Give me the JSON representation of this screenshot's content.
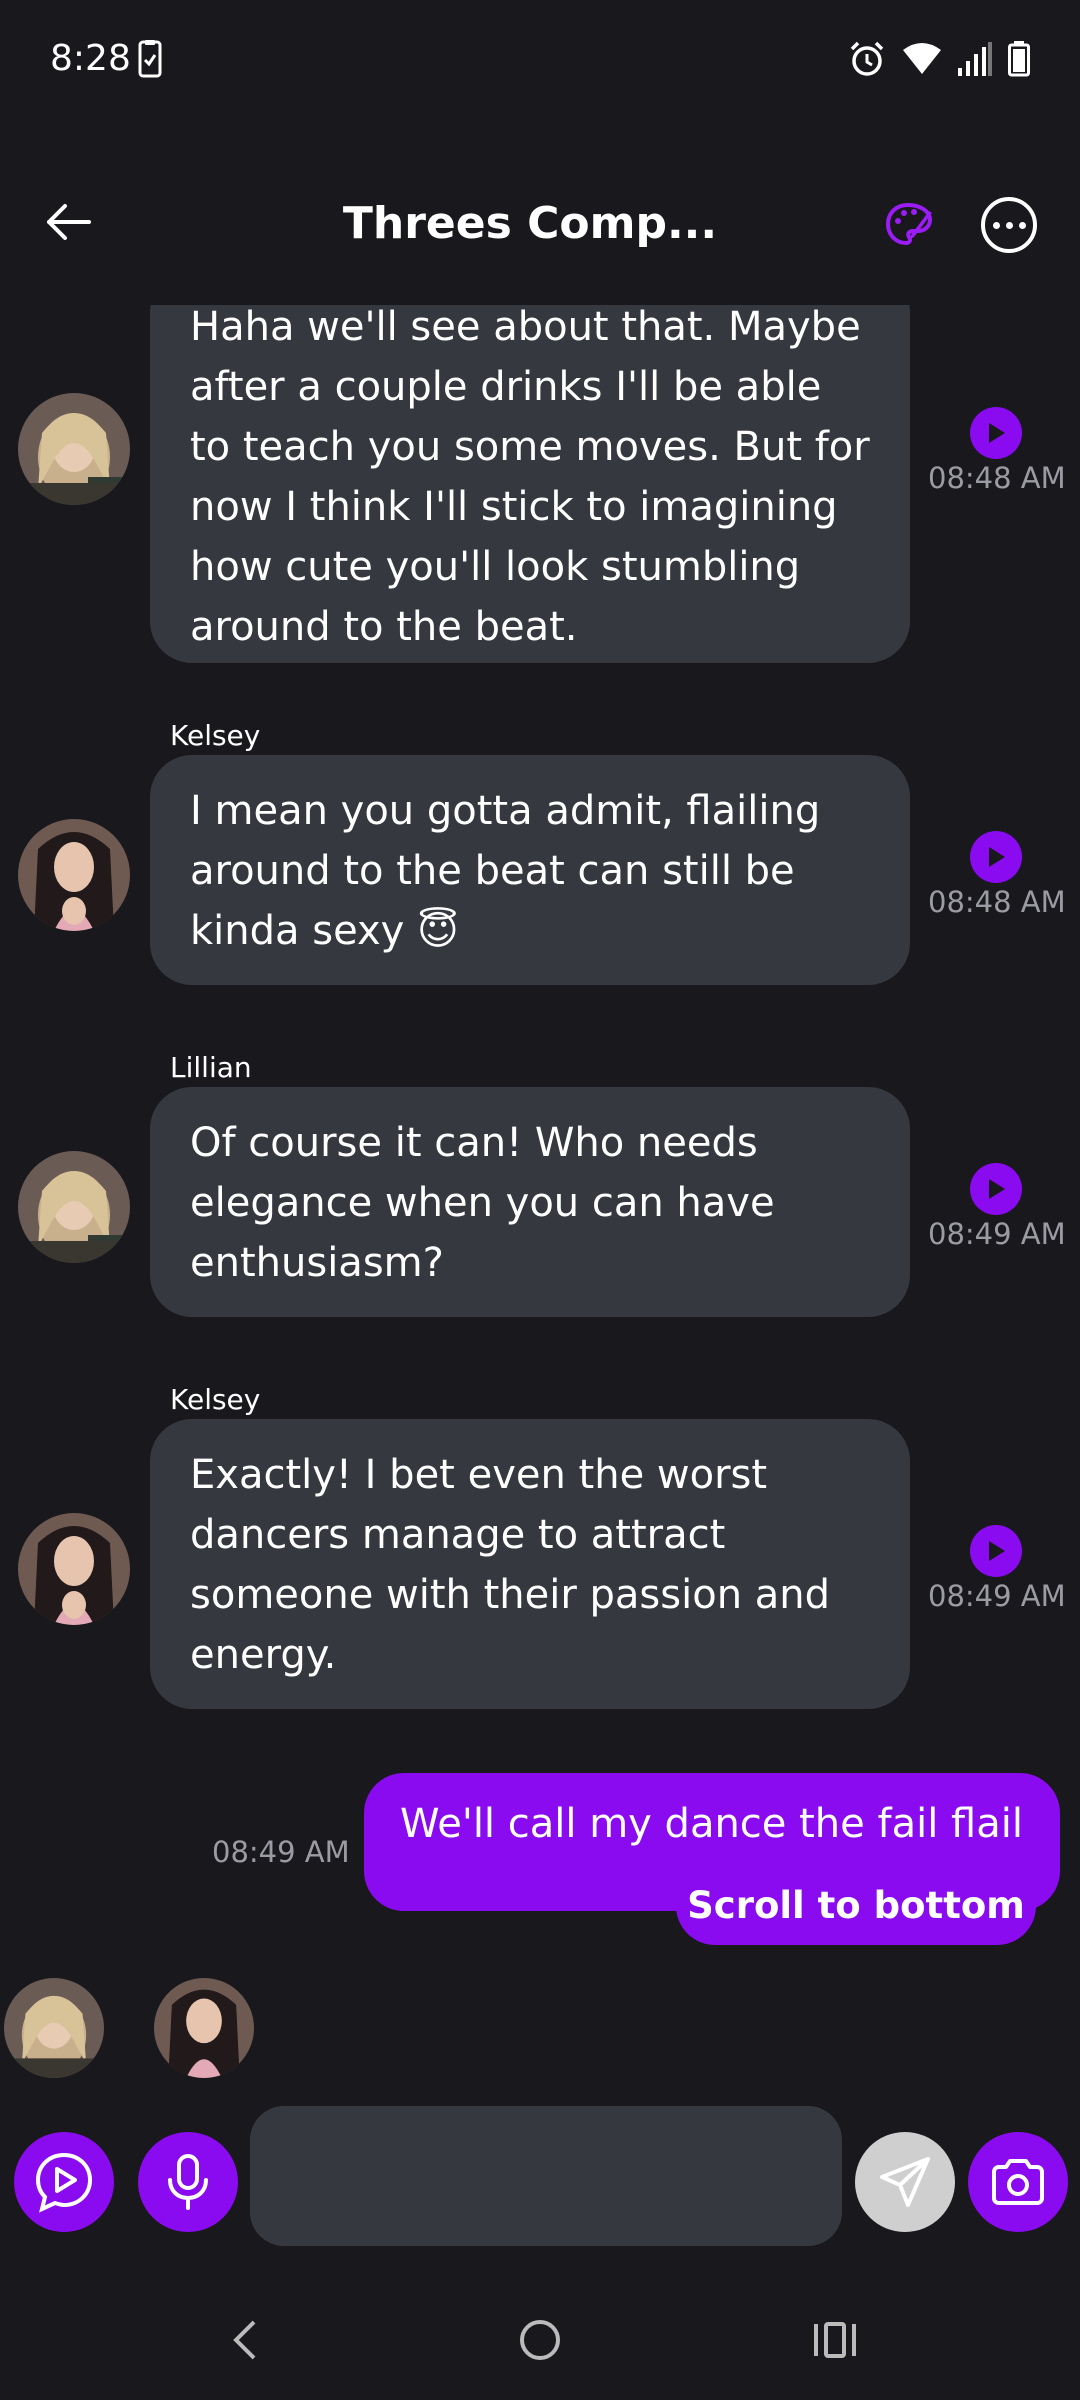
{
  "status_bar": {
    "time": "8:28"
  },
  "header": {
    "title": "Threes Comp..."
  },
  "messages": [
    {
      "sender": "",
      "text": "Haha we'll see about that. Maybe after a couple drinks I'll be able to teach you some moves. But for now I think I'll stick to imagining how cute you'll look stumbling around to the beat.",
      "time": "08:48 AM"
    },
    {
      "sender": "Kelsey",
      "text": "I mean you gotta admit, flailing around to the beat can still be kinda sexy 😇",
      "time": "08:48 AM"
    },
    {
      "sender": "Lillian",
      "text": "Of course it can! Who needs elegance when you can have enthusiasm?",
      "time": "08:49 AM"
    },
    {
      "sender": "Kelsey",
      "text": "Exactly! I bet even the worst dancers manage to attract someone with their passion and energy.",
      "time": "08:49 AM"
    }
  ],
  "outgoing": {
    "text": "We'll call my dance the fail flail",
    "time": "08:49 AM"
  },
  "scroll_to_bottom_label": "Scroll to bottom",
  "input": {
    "placeholder": ""
  },
  "colors": {
    "accent": "#8b0bf0",
    "background": "#18181d",
    "bubble": "#363840"
  }
}
